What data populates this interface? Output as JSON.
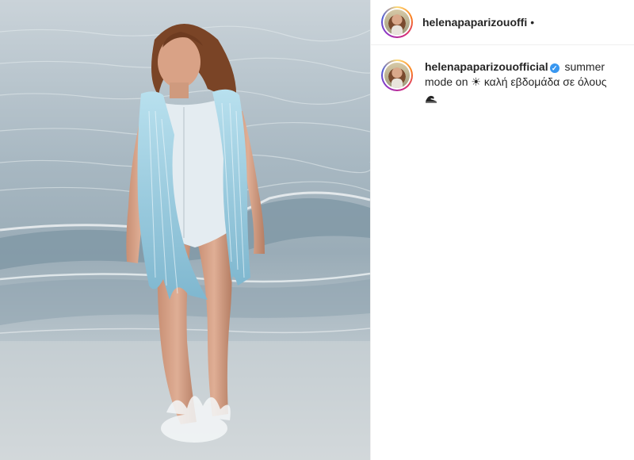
{
  "post": {
    "username": "helenapaparizouoffi",
    "header_separator": "•"
  },
  "caption": {
    "username": "helenapaparizouofficial",
    "verified": true,
    "text_part1": "summer mode on",
    "sun_emoji": "☀",
    "text_part2": "καλή εβδομάδα σε όλους",
    "wave_emoji": "wave-icon"
  },
  "photo": {
    "description_icon": "beach-photo"
  }
}
